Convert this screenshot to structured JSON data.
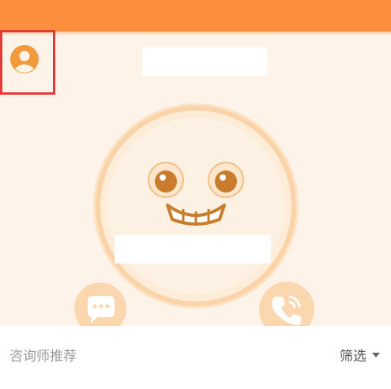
{
  "header": {
    "bar_color": "#fb8f3d"
  },
  "avatar": {
    "icon": "user-avatar-icon",
    "color": "#f39a3c"
  },
  "mascot": {
    "icon": "smiling-face-icon",
    "ring_color": "#fbd7b0"
  },
  "actions": {
    "chat_icon": "chat-bubble-icon",
    "call_icon": "phone-icon"
  },
  "bottom": {
    "tab_label": "咨询师推荐",
    "filter_label": "筛选"
  }
}
